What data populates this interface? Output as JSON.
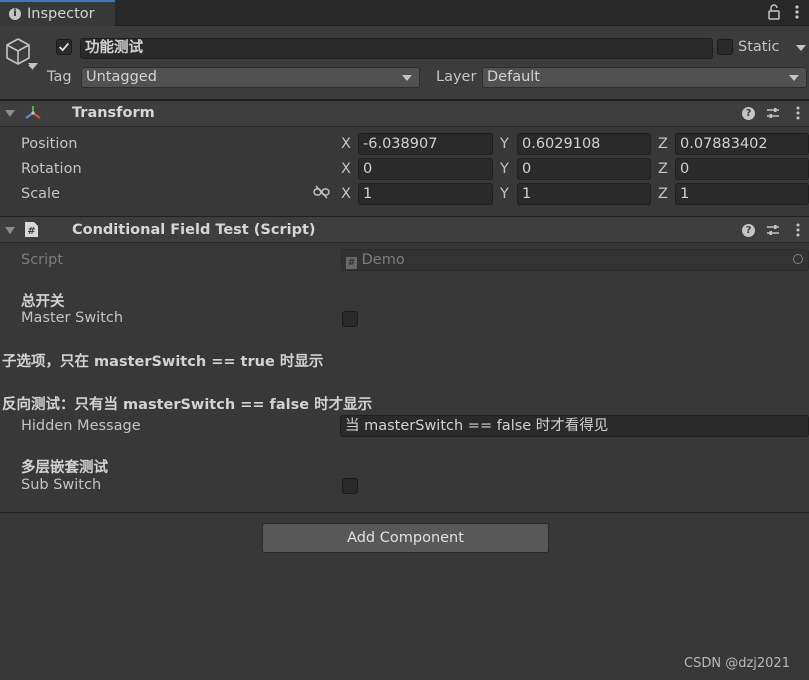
{
  "tab": {
    "icon": "info-icon",
    "label": "Inspector",
    "lock_icon": "lock-icon",
    "menu_icon": "kebab-menu-icon"
  },
  "header": {
    "object_icon": "cube-icon",
    "active": true,
    "name": "功能测试",
    "static_label": "Static",
    "static_checked": false,
    "tag_label": "Tag",
    "tag_value": "Untagged",
    "layer_label": "Layer",
    "layer_value": "Default"
  },
  "transform": {
    "icon": "transform-icon",
    "title": "Transform",
    "rows": [
      {
        "label": "Position",
        "x": "-6.038907",
        "y": "0.6029108",
        "z": "0.07883402"
      },
      {
        "label": "Rotation",
        "x": "0",
        "y": "0",
        "z": "0"
      },
      {
        "label": "Scale",
        "x": "1",
        "y": "1",
        "z": "1"
      }
    ],
    "axis_x": "X",
    "axis_y": "Y",
    "axis_z": "Z"
  },
  "script_component": {
    "icon": "script-icon",
    "title": "Conditional Field Test (Script)",
    "script_label": "Script",
    "script_value": "Demo",
    "header1": "总开关",
    "master_switch_label": "Master Switch",
    "header2": "子选项，只在 masterSwitch == true 时显示",
    "header3": "反向测试：只有当 masterSwitch == false 时才显示",
    "hidden_message_label": "Hidden Message",
    "hidden_message_value": "当 masterSwitch == false 时才看得见",
    "header4": "多层嵌套测试",
    "sub_switch_label": "Sub Switch"
  },
  "add_component_label": "Add Component",
  "watermark": "CSDN @dzj2021",
  "colors": {
    "tab_accent": "#3a79bb",
    "background": "#383838",
    "field": "#2a2a2a"
  }
}
